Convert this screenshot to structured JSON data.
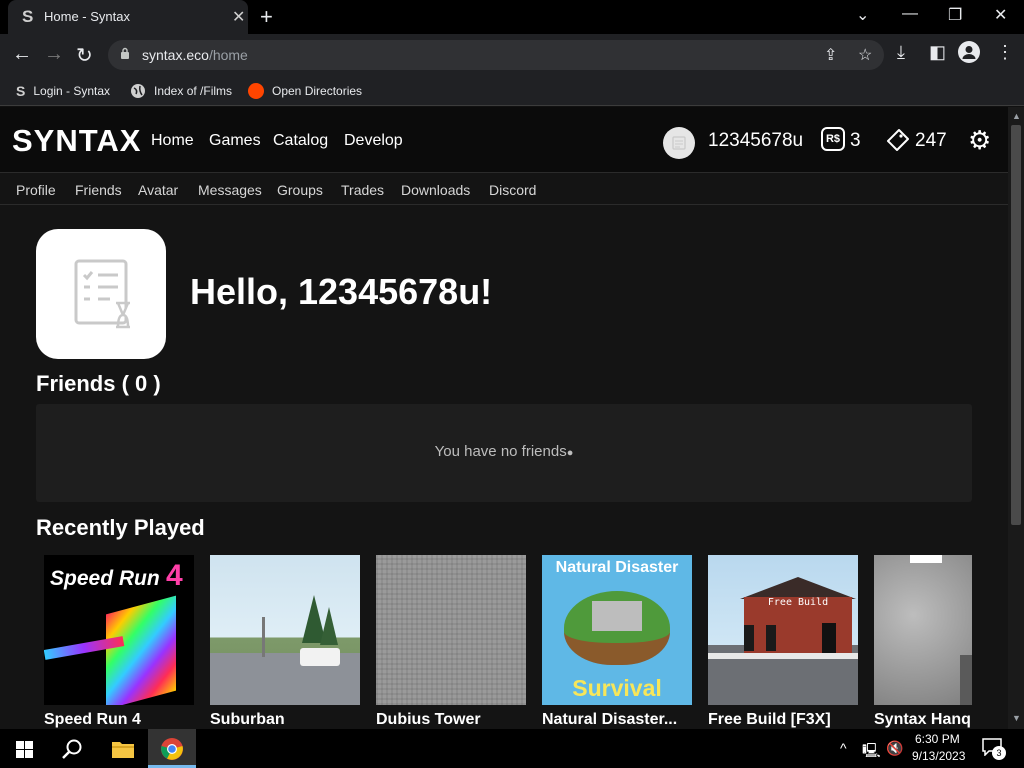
{
  "browser": {
    "tab_title": "Home - Syntax",
    "tab_favicon": "S",
    "url_host": "syntax.eco",
    "url_path": "/home",
    "bookmarks": [
      {
        "icon": "S",
        "label": "Login - Syntax"
      },
      {
        "icon": "globe-icon",
        "label": "Index of /Films"
      },
      {
        "icon": "reddit-icon",
        "label": "Open Directories"
      }
    ]
  },
  "site": {
    "logo": "SYNTAX",
    "main_nav": [
      "Home",
      "Games",
      "Catalog",
      "Develop"
    ],
    "username": "12345678u",
    "robux_icon": "R$",
    "robux": "3",
    "tickets": "247",
    "sub_nav": [
      "Profile",
      "Friends",
      "Avatar",
      "Messages",
      "Groups",
      "Trades",
      "Downloads",
      "Discord"
    ],
    "greeting": "Hello, 12345678u!",
    "friends_heading": "Friends ( 0 )",
    "no_friends": "You have no friends",
    "recent_heading": "Recently Played",
    "games": [
      {
        "title": "Speed Run 4",
        "thumb_text": "Speed Run",
        "thumb_num": "4"
      },
      {
        "title": "Suburban"
      },
      {
        "title": "Dubius Tower"
      },
      {
        "title": "Natural Disaster...",
        "thumb_top": "Natural Disaster",
        "thumb_bottom": "Survival"
      },
      {
        "title": "Free Build [F3X]",
        "thumb_sign": "Free Build"
      },
      {
        "title": "Syntax Hanq"
      }
    ]
  },
  "taskbar": {
    "time": "6:30 PM",
    "date": "9/13/2023",
    "notifications": "3"
  },
  "colors": {
    "background": "#141414",
    "panel": "#1e1e1e",
    "chrome": "#202124"
  }
}
